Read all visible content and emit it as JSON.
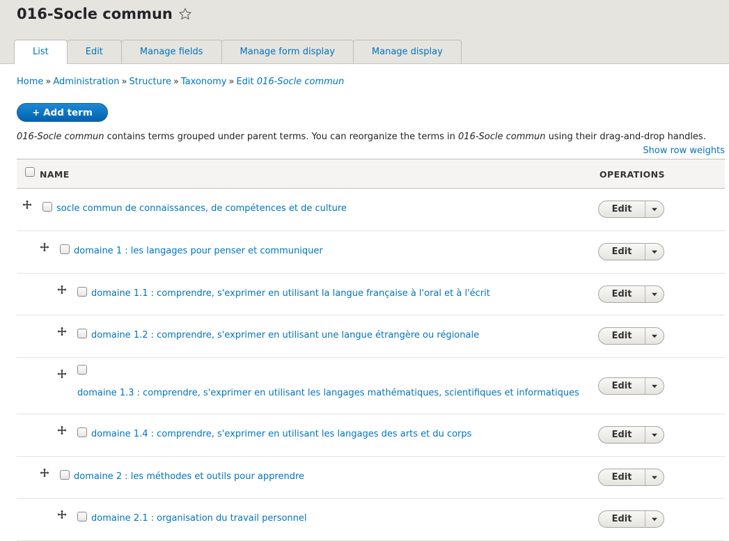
{
  "page": {
    "title": "016-Socle commun"
  },
  "tabs": [
    {
      "label": "List",
      "active": true
    },
    {
      "label": "Edit",
      "active": false
    },
    {
      "label": "Manage fields",
      "active": false
    },
    {
      "label": "Manage form display",
      "active": false
    },
    {
      "label": "Manage display",
      "active": false
    }
  ],
  "breadcrumb": {
    "items": [
      "Home",
      "Administration",
      "Structure",
      "Taxonomy"
    ],
    "current_prefix": "Edit",
    "current_em": "016-Socle commun",
    "separator": "»"
  },
  "actions": {
    "add_term": "+ Add term",
    "show_row_weights": "Show row weights"
  },
  "description": {
    "em1": "016-Socle commun",
    "text1": " contains terms grouped under parent terms. You can reorganize the terms in ",
    "em2": "016-Socle commun",
    "text2": " using their drag-and-drop handles."
  },
  "table": {
    "headers": {
      "name": "NAME",
      "operations": "OPERATIONS"
    },
    "edit_label": "Edit",
    "rows": [
      {
        "name": "socle commun de connaissances, de compétences et de culture",
        "depth": 0
      },
      {
        "name": "domaine 1 : les langages pour penser et communiquer",
        "depth": 1
      },
      {
        "name": "domaine 1.1 : comprendre, s'exprimer en utilisant la langue française à l'oral et à l'écrit",
        "depth": 2
      },
      {
        "name": "domaine 1.2 : comprendre, s'exprimer en utilisant une langue étrangère ou régionale",
        "depth": 2
      },
      {
        "name": "domaine 1.3 : comprendre, s'exprimer en utilisant les langages mathématiques, scientifiques et informatiques",
        "depth": 2
      },
      {
        "name": "domaine 1.4 : comprendre, s'exprimer en utilisant les langages des arts et du corps",
        "depth": 2
      },
      {
        "name": "domaine 2 : les méthodes et outils pour apprendre",
        "depth": 1
      },
      {
        "name": "domaine 2.1 : organisation du travail personnel",
        "depth": 2
      }
    ]
  },
  "icons": {
    "favorite": "star-outline-icon",
    "drag": "drag-handle-icon",
    "dropdown": "caret-down-icon"
  },
  "colors": {
    "link": "#0074bd",
    "primary_button": "#0063b0",
    "header_bg": "#e6e4df"
  }
}
